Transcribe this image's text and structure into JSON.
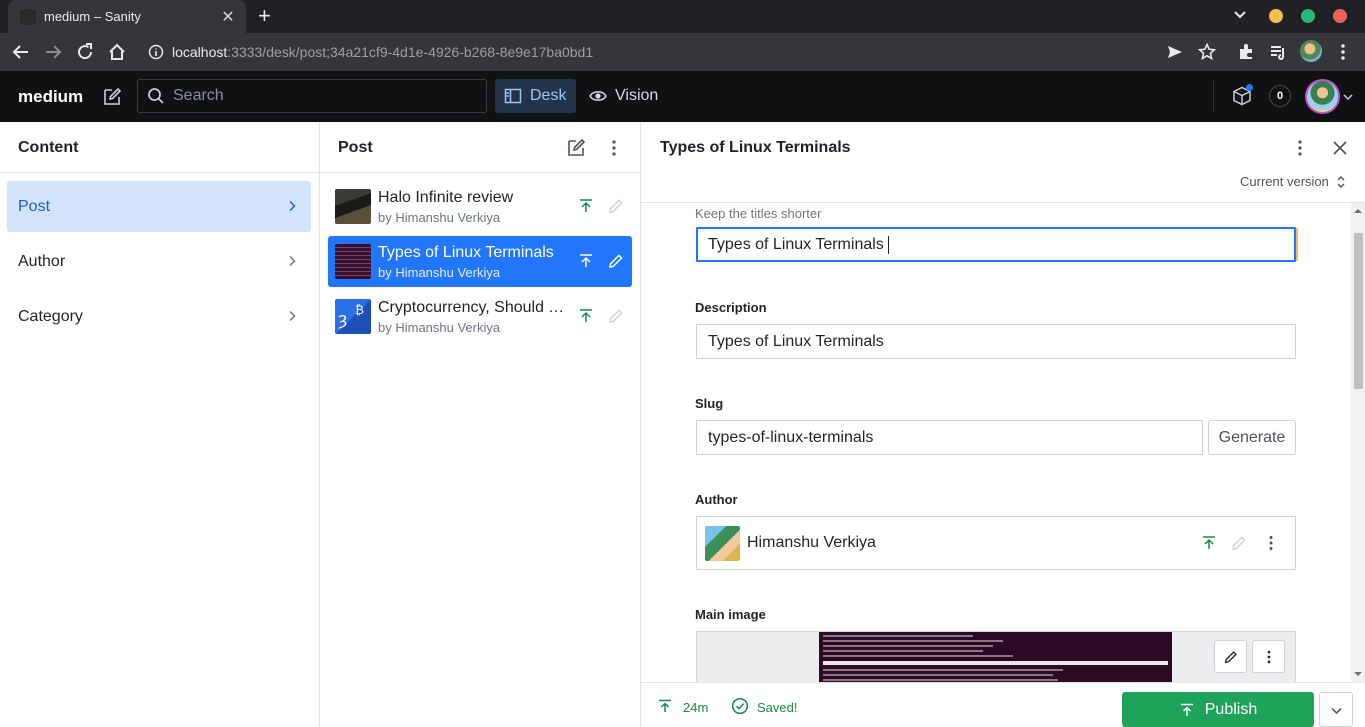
{
  "browser": {
    "tab_title": "medium – Sanity",
    "url_host": "localhost",
    "url_rest": ":3333/desk/post;34a21cf9-4d1e-4926-b268-8e9e17ba0bd1"
  },
  "navbar": {
    "brand": "medium",
    "search_placeholder": "Search",
    "tools": [
      {
        "label": "Desk",
        "icon": "desk-icon",
        "active": true
      },
      {
        "label": "Vision",
        "icon": "eye-icon",
        "active": false
      }
    ],
    "notification_count": "0"
  },
  "content_pane": {
    "title": "Content",
    "items": [
      {
        "label": "Post",
        "active": true
      },
      {
        "label": "Author",
        "active": false
      },
      {
        "label": "Category",
        "active": false
      }
    ]
  },
  "post_pane": {
    "title": "Post",
    "documents": [
      {
        "title": "Halo Infinite review",
        "subtitle": "by Himanshu Verkiya",
        "active": false
      },
      {
        "title": "Types of Linux Terminals",
        "subtitle": "by Himanshu Verkiya",
        "active": true
      },
      {
        "title": "Cryptocurrency, Should You Invest?",
        "subtitle": "by Himanshu Verkiya",
        "active": false
      }
    ]
  },
  "editor": {
    "title": "Types of Linux Terminals",
    "version": "Current version",
    "title_hint": "Keep the titles shorter",
    "title_value": "Types of Linux Terminals",
    "description_label": "Description",
    "description_value": "Types of Linux Terminals",
    "slug_label": "Slug",
    "slug_value": "types-of-linux-terminals",
    "generate_label": "Generate",
    "author_label": "Author",
    "author_name": "Himanshu Verkiya",
    "main_image_label": "Main image",
    "footer": {
      "published_ago": "24m",
      "saved": "Saved!",
      "publish_label": "Publish"
    }
  },
  "colors": {
    "accent": "#2276fc",
    "publish_green": "#1fa35a",
    "navbar_bg": "#101112",
    "selected_bg": "#d3e3fa"
  }
}
